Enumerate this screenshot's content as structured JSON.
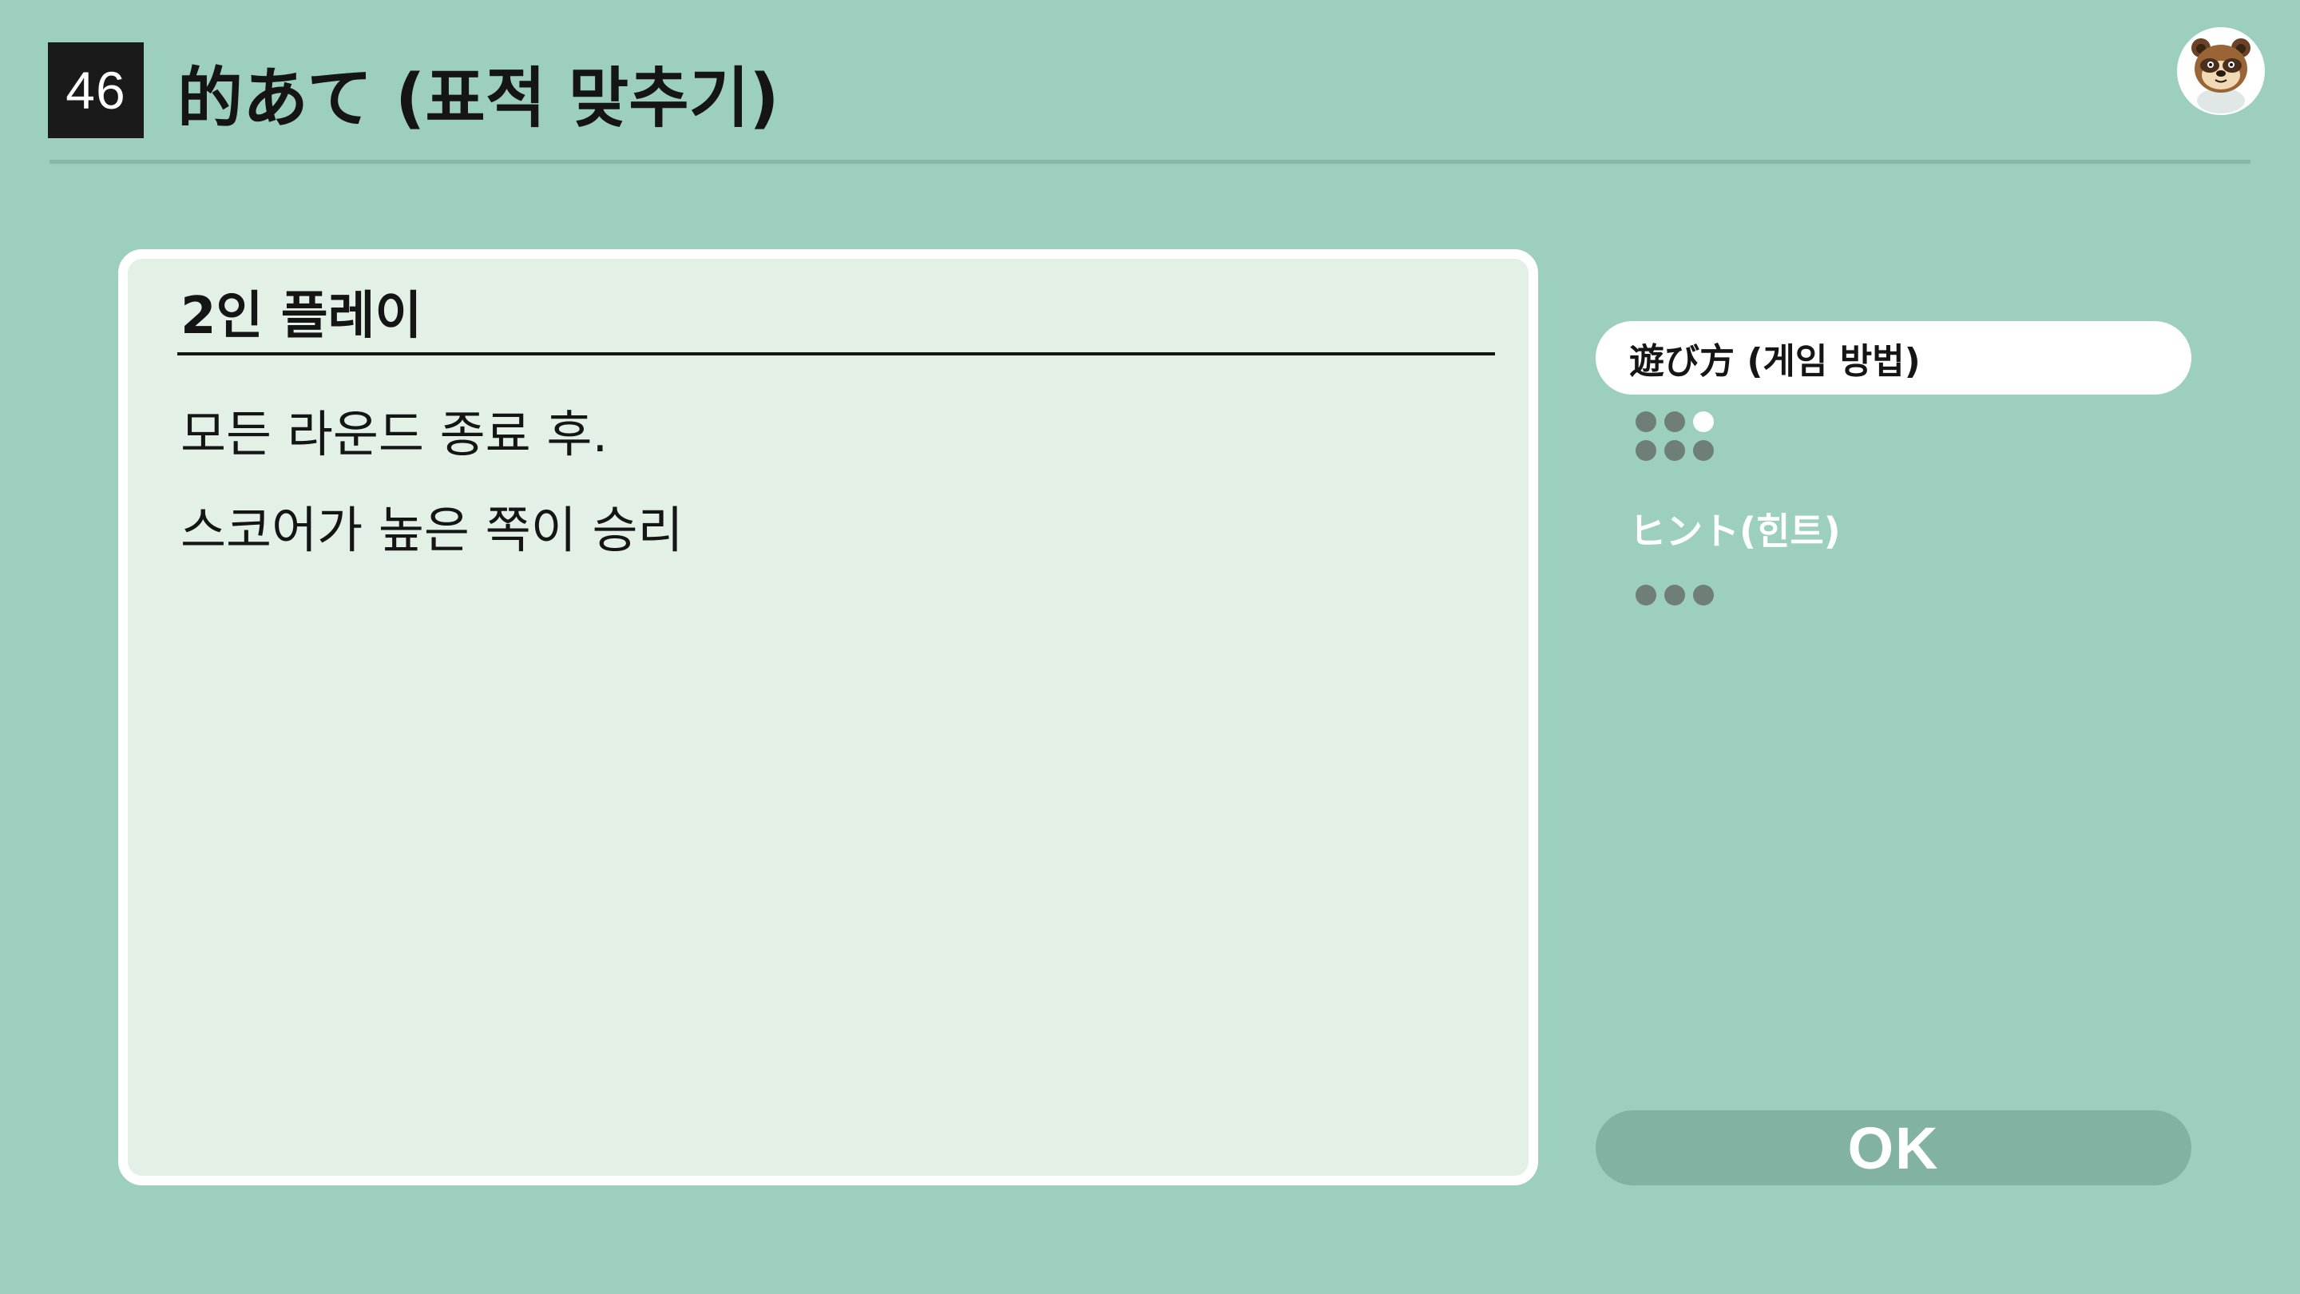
{
  "header": {
    "game_number": "46",
    "title": "的あて (표적 맞추기)",
    "avatar_icon": "tanuki-character-icon"
  },
  "panel": {
    "title": "2인 플레이",
    "lines": [
      "모든 라운드 종료 후.",
      "스코어가 높은 쪽이 승리"
    ]
  },
  "side_menu": {
    "items": [
      {
        "label": "遊び方 (게임 방법)",
        "active": true,
        "pages": 6,
        "current_page": 3
      },
      {
        "label": "ヒント(힌트)",
        "active": false,
        "pages": 3,
        "current_page": 0
      }
    ]
  },
  "ok_button": {
    "label": "OK"
  },
  "colors": {
    "background": "#9ccfbe",
    "panel_background": "#e2f0e6",
    "ok_button": "#82b2a2",
    "dot_inactive": "#6f7f78",
    "dot_active": "#ffffff"
  }
}
